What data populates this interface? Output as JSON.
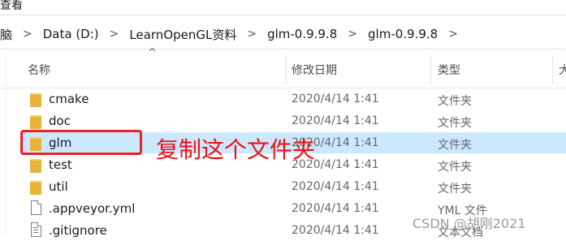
{
  "top_strip": {
    "text": "查看"
  },
  "address_bar": {
    "lead_char": "脑",
    "crumbs": [
      "Data (D:)",
      "LearnOpenGL资料",
      "glm-0.9.9.8",
      "glm-0.9.9.8"
    ],
    "separator": ">"
  },
  "columns": {
    "name": "名称",
    "date": "修改日期",
    "type": "类型",
    "size_partial": "大"
  },
  "sort_indicator": "^",
  "files": [
    {
      "name": "cmake",
      "date": "2020/4/14 1:41",
      "type": "文件夹",
      "icon": "folder-icon"
    },
    {
      "name": "doc",
      "date": "2020/4/14 1:41",
      "type": "文件夹",
      "icon": "folder-icon"
    },
    {
      "name": "glm",
      "date": "2020/4/14 1:41",
      "type": "文件夹",
      "icon": "folder-icon",
      "selected": true
    },
    {
      "name": "test",
      "date": "2020/4/14 1:41",
      "type": "文件夹",
      "icon": "folder-icon"
    },
    {
      "name": "util",
      "date": "2020/4/14 1:41",
      "type": "文件夹",
      "icon": "folder-icon"
    },
    {
      "name": ".appveyor.yml",
      "date": "2020/4/14 1:41",
      "type": "YML 文件",
      "icon": "file-icon"
    },
    {
      "name": ".gitignore",
      "date": "2020/4/14 1:41",
      "type": "文本文档",
      "icon": "text-file-icon"
    }
  ],
  "annotation": {
    "text": "复制这个文件夹",
    "color": "#ee1111"
  },
  "watermark": "CSDN @胡刚2021",
  "colors": {
    "selection": "#cce8ff",
    "folder": "#e8b33a",
    "highlight_box": "#ee2222"
  }
}
